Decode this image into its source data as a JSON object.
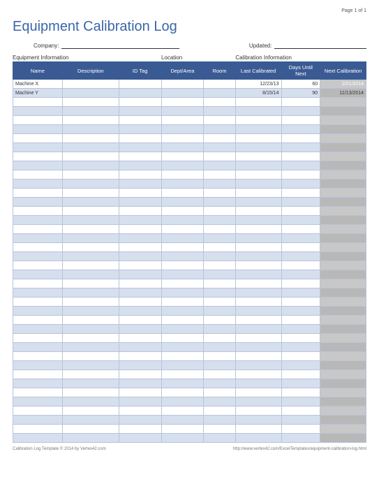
{
  "page_indicator": "Page 1 of 1",
  "title": "Equipment Calibration Log",
  "meta": {
    "company_label": "Company:",
    "updated_label": "Updated:"
  },
  "sections": {
    "equipment": "Equipment Information",
    "location": "Location",
    "calibration": "Calibration Information"
  },
  "headers": {
    "name": "Name",
    "description": "Description",
    "idtag": "ID Tag",
    "dept": "Dept/Area",
    "room": "Room",
    "last": "Last Calibrated",
    "days": "Days Until Next",
    "next": "Next Calibration"
  },
  "rows": [
    {
      "name": "Machine X",
      "desc": "",
      "idtag": "",
      "dept": "",
      "room": "",
      "last": "12/23/13",
      "days": "60",
      "next": "2/21/2014",
      "overdue": true
    },
    {
      "name": "Machine Y",
      "desc": "",
      "idtag": "",
      "dept": "",
      "room": "",
      "last": "8/15/14",
      "days": "90",
      "next": "11/13/2014",
      "overdue": false
    }
  ],
  "blank_rows": 38,
  "footer": {
    "left": "Calibration Log Template © 2014 by Vertex42.com",
    "right": "http://www.vertex42.com/ExcelTemplates/equipment-calibration-log.html"
  }
}
